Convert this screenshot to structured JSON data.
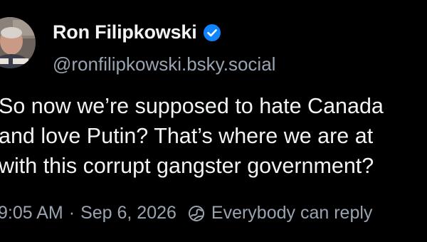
{
  "author": {
    "display_name": "Ron Filipkowski",
    "handle": "@ronfilipkowski.bsky.social",
    "verified": true,
    "avatar_icon": "avatar-photo"
  },
  "post": {
    "lines": [
      "So now we’re supposed to hate Canada",
      "and love Putin? That’s where we are at",
      "with this corrupt gangster government?"
    ]
  },
  "meta": {
    "time": "9:05 AM",
    "separator": "·",
    "date": "Sep 6, 2026",
    "reply_setting": "Everybody can reply",
    "reply_icon": "globe-icon"
  },
  "colors": {
    "background": "#000000",
    "text_primary": "#f1f3f5",
    "text_secondary": "#9aa4b1",
    "verified_badge": "#1083fe"
  }
}
